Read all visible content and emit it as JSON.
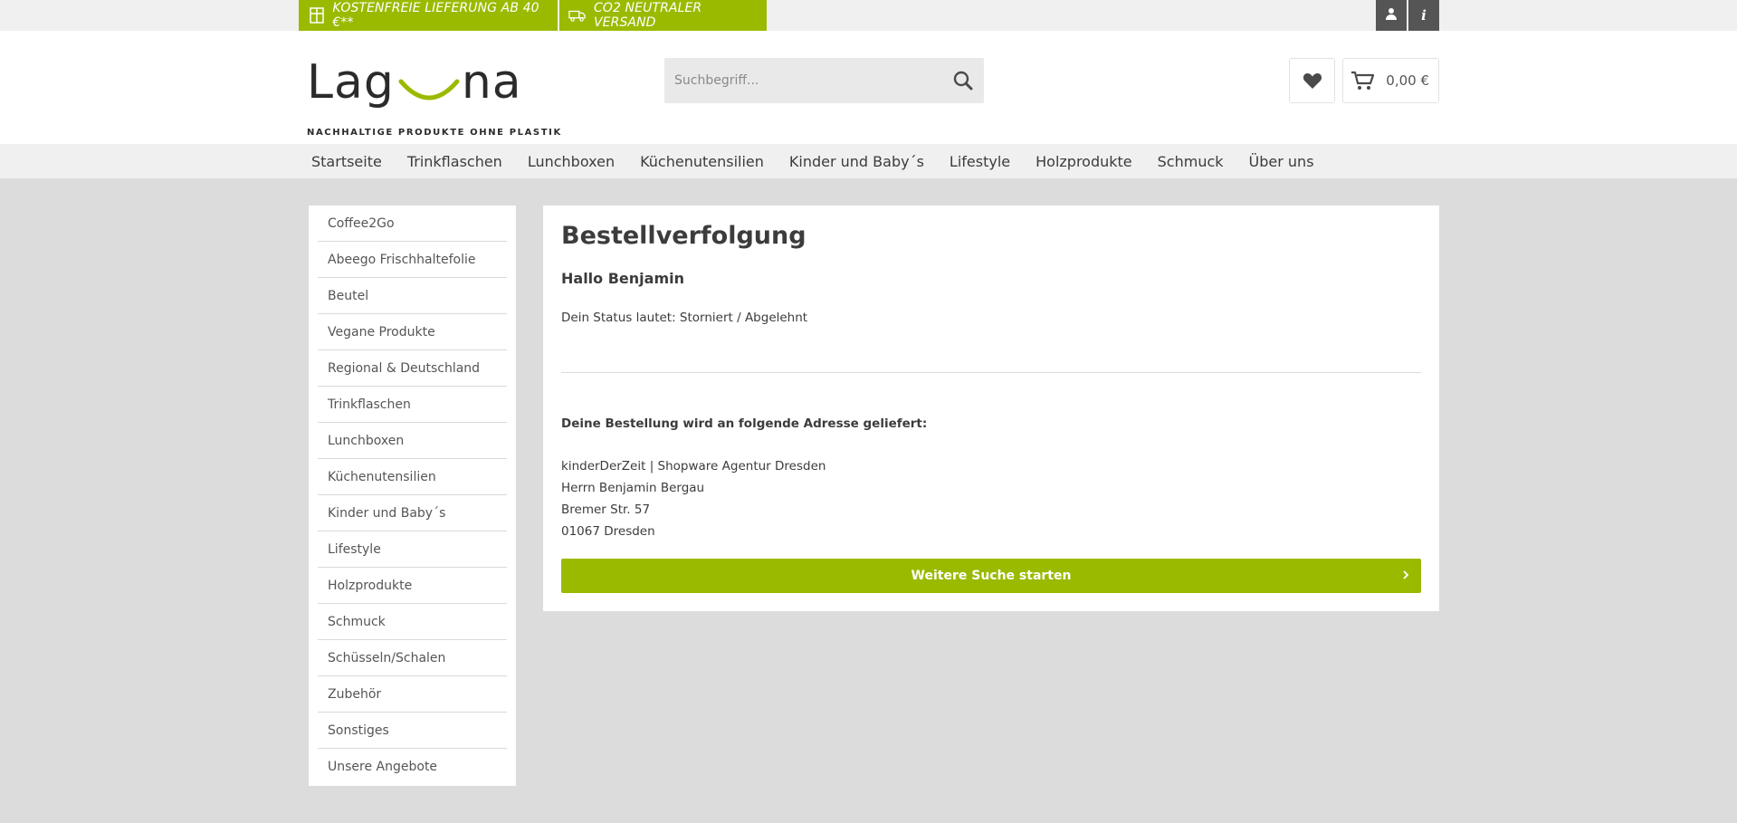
{
  "topbar": {
    "promo1": "KOSTENFREIE LIEFERUNG AB 40 €**",
    "promo2": "CO2 NEUTRALER VERSAND",
    "info_glyph": "i"
  },
  "header": {
    "logo_left": "Lag",
    "logo_right": "na",
    "logo_tagline": "NACHHALTIGE  PRODUKTE  OHNE  PLASTIK",
    "search_placeholder": "Suchbegriff...",
    "cart_amount": "0,00 €"
  },
  "nav": {
    "items": [
      "Startseite",
      "Trinkflaschen",
      "Lunchboxen",
      "Küchenutensilien",
      "Kinder und Baby´s",
      "Lifestyle",
      "Holzprodukte",
      "Schmuck",
      "Über uns"
    ]
  },
  "sidebar": {
    "items": [
      "Coffee2Go",
      "Abeego Frischhaltefolie",
      "Beutel",
      "Vegane Produkte",
      "Regional & Deutschland",
      "Trinkflaschen",
      "Lunchboxen",
      "Küchenutensilien",
      "Kinder und Baby´s",
      "Lifestyle",
      "Holzprodukte",
      "Schmuck",
      "Schüsseln/Schalen",
      "Zubehör",
      "Sonstiges",
      "Unsere Angebote"
    ]
  },
  "main": {
    "title": "Bestellverfolgung",
    "greeting": "Hallo Benjamin",
    "status": "Dein Status lautet: Storniert / Abgelehnt",
    "address_title": "Deine Bestellung wird an folgende Adresse geliefert:",
    "address": [
      "kinderDerZeit | Shopware Agentur Dresden",
      "Herrn Benjamin Bergau",
      "Bremer Str. 57",
      "01067 Dresden"
    ],
    "button_label": "Weitere Suche starten"
  },
  "colors": {
    "accent": "#9aba00",
    "background": "#dcdcdc",
    "topbar_button": "#555555"
  }
}
